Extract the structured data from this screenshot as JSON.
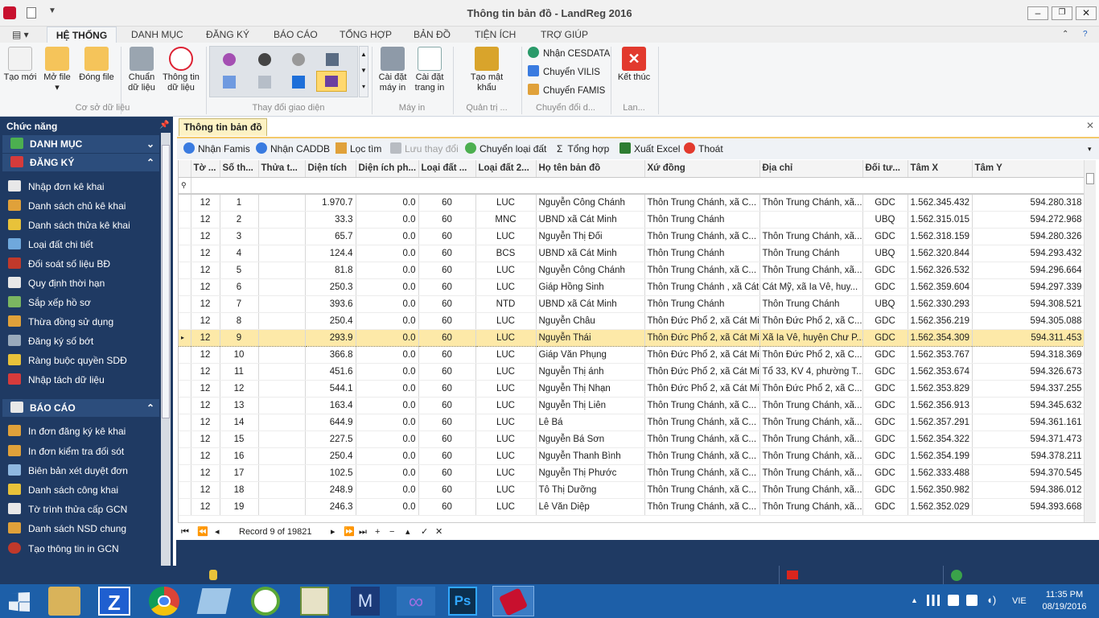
{
  "window": {
    "title": "Thông tin bản đồ - LandReg 2016"
  },
  "ribbon_tabs": [
    "HỆ THỐNG",
    "DANH MỤC",
    "ĐĂNG KÝ",
    "BÁO CÁO",
    "TỔNG HỢP",
    "BẢN ĐỒ",
    "TIỆN ÍCH",
    "TRỢ GIÚP"
  ],
  "ribbon": {
    "new": "Tạo mới",
    "open": "Mở file",
    "close": "Đóng file",
    "convert": "Chuẩn dữ liệu",
    "info": "Thông tin dữ liệu",
    "group1": "Cơ sở dữ liệu",
    "group2": "Thay đổi giao diện",
    "printer": "Cài đặt máy in",
    "page": "Cài đặt trang in",
    "group3": "Máy in",
    "password": "Tạo mật khẩu",
    "group4": "Quản trị ...",
    "cesdata": "Nhận CESDATA",
    "vilis": "Chuyển VILIS",
    "famis": "Chuyển FAMIS",
    "group5": "Chuyển đổi d...",
    "exit": "Kết thúc",
    "group6": "Lan..."
  },
  "left_panel": {
    "title": "Chức năng",
    "sec1": "DANH MỤC",
    "sec2": "ĐĂNG KÝ",
    "dangky_items": [
      "Nhập đơn kê khai",
      "Danh sách chủ kê khai",
      "Danh sách thửa kê khai",
      "Loại đất chi tiết",
      "Đối soát số liệu BĐ",
      "Quy định thời hạn",
      "Sắp xếp hồ sơ",
      "Thừa đồng sử dụng",
      "Đăng ký số bớt",
      "Ràng buộc quyền SDĐ",
      "Nhập tách dữ liệu"
    ],
    "sec3": "BÁO CÁO",
    "baocao_items": [
      "In đơn đăng ký kê khai",
      "In đơn kiểm tra đối sót",
      "Biên bản xét duyệt đơn",
      "Danh sách công khai",
      "Tờ trình thửa cấp GCN",
      "Danh sách NSD chung",
      "Tạo thông tin in GCN"
    ]
  },
  "doc_tab": "Thông tin bản đồ",
  "toolbar": {
    "famis": "Nhận Famis",
    "caddb": "Nhận CADDB",
    "filter": "Lọc tìm",
    "save": "Lưu thay đổi",
    "convert": "Chuyển loại đất",
    "sum": "Tổng hợp",
    "excel": "Xuất Excel",
    "exit": "Thoát"
  },
  "columns": [
    "Tờ ...",
    "Số th...",
    "Thửa t...",
    "Diện tích",
    "Diện ích ph...",
    "Loại đất ...",
    "Loại đất 2...",
    "Họ tên bản đồ",
    "Xứ đồng",
    "Địa chỉ",
    "Đối tư...",
    "Tâm X",
    "Tâm Y"
  ],
  "rows": [
    [
      "12",
      "1",
      "",
      "1.970.7",
      "0.0",
      "60",
      "LUC",
      "Nguyễn Công Chánh",
      "Thôn Trung Chánh, xã C...",
      "Thôn Trung Chánh, xã...",
      "GDC",
      "1.562.345.432",
      "594.280.318"
    ],
    [
      "12",
      "2",
      "",
      "33.3",
      "0.0",
      "60",
      "MNC",
      "UBND xã Cát Minh",
      "Thôn Trung Chánh",
      "",
      "UBQ",
      "1.562.315.015",
      "594.272.968"
    ],
    [
      "12",
      "3",
      "",
      "65.7",
      "0.0",
      "60",
      "LUC",
      "Nguyễn Thị Đối",
      "Thôn Trung Chánh, xã C...",
      "Thôn Trung Chánh, xã...",
      "GDC",
      "1.562.318.159",
      "594.280.326"
    ],
    [
      "12",
      "4",
      "",
      "124.4",
      "0.0",
      "60",
      "BCS",
      "UBND xã Cát Minh",
      "Thôn Trung Chánh",
      "Thôn Trung Chánh",
      "UBQ",
      "1.562.320.844",
      "594.293.432"
    ],
    [
      "12",
      "5",
      "",
      "81.8",
      "0.0",
      "60",
      "LUC",
      "Nguyễn Công Chánh",
      "Thôn Trung Chánh, xã C...",
      "Thôn Trung Chánh, xã...",
      "GDC",
      "1.562.326.532",
      "594.296.664"
    ],
    [
      "12",
      "6",
      "",
      "250.3",
      "0.0",
      "60",
      "LUC",
      "Giáp Hồng Sinh",
      "Thôn Trung Chánh , xã Cát",
      "Cát Mỹ, xã Ia Vê, huy...",
      "GDC",
      "1.562.359.604",
      "594.297.339"
    ],
    [
      "12",
      "7",
      "",
      "393.6",
      "0.0",
      "60",
      "NTD",
      "UBND xã Cát Minh",
      "Thôn Trung Chánh",
      "Thôn Trung Chánh",
      "UBQ",
      "1.562.330.293",
      "594.308.521"
    ],
    [
      "12",
      "8",
      "",
      "250.4",
      "0.0",
      "60",
      "LUC",
      "Nguyễn Châu",
      "Thôn Đức Phổ 2, xã Cát Min",
      "Thôn Đức Phổ 2, xã C...",
      "GDC",
      "1.562.356.219",
      "594.305.088"
    ],
    [
      "12",
      "9",
      "",
      "293.9",
      "0.0",
      "60",
      "LUC",
      "Nguyễn Thái",
      "Thôn Đức Phổ 2, xã Cát Min",
      "Xã Ia Vê, huyện Chư P...",
      "GDC",
      "1.562.354.309",
      "594.311.453"
    ],
    [
      "12",
      "10",
      "",
      "366.8",
      "0.0",
      "60",
      "LUC",
      "Giáp Văn Phụng",
      "Thôn Đức Phổ 2, xã Cát Min",
      "Thôn Đức Phổ 2, xã C...",
      "GDC",
      "1.562.353.767",
      "594.318.369"
    ],
    [
      "12",
      "11",
      "",
      "451.6",
      "0.0",
      "60",
      "LUC",
      "Nguyễn Thị ánh",
      "Thôn Đức Phổ 2, xã Cát Min",
      "Tổ 33, KV 4, phường T...",
      "GDC",
      "1.562.353.674",
      "594.326.673"
    ],
    [
      "12",
      "12",
      "",
      "544.1",
      "0.0",
      "60",
      "LUC",
      "Nguyễn Thị Nhạn",
      "Thôn Đức Phổ 2, xã Cát Min",
      "Thôn Đức Phổ 2, xã C...",
      "GDC",
      "1.562.353.829",
      "594.337.255"
    ],
    [
      "12",
      "13",
      "",
      "163.4",
      "0.0",
      "60",
      "LUC",
      "Nguyễn Thị Liên",
      "Thôn Trung Chánh, xã C...",
      "Thôn Trung Chánh, xã...",
      "GDC",
      "1.562.356.913",
      "594.345.632"
    ],
    [
      "12",
      "14",
      "",
      "644.9",
      "0.0",
      "60",
      "LUC",
      "Lê Bá",
      "Thôn Trung Chánh, xã C...",
      "Thôn Trung Chánh, xã...",
      "GDC",
      "1.562.357.291",
      "594.361.161"
    ],
    [
      "12",
      "15",
      "",
      "227.5",
      "0.0",
      "60",
      "LUC",
      "Nguyễn Bá Sơn",
      "Thôn Trung Chánh, xã C...",
      "Thôn Trung Chánh, xã...",
      "GDC",
      "1.562.354.322",
      "594.371.473"
    ],
    [
      "12",
      "16",
      "",
      "250.4",
      "0.0",
      "60",
      "LUC",
      "Nguyễn Thanh Bình",
      "Thôn Trung Chánh, xã C...",
      "Thôn Trung Chánh, xã...",
      "GDC",
      "1.562.354.199",
      "594.378.211"
    ],
    [
      "12",
      "17",
      "",
      "102.5",
      "0.0",
      "60",
      "LUC",
      "Nguyễn Thị Phước",
      "Thôn Trung Chánh, xã C...",
      "Thôn Trung Chánh, xã...",
      "GDC",
      "1.562.333.488",
      "594.370.545"
    ],
    [
      "12",
      "18",
      "",
      "248.9",
      "0.0",
      "60",
      "LUC",
      "Tô Thị Dưỡng",
      "Thôn Trung Chánh, xã C...",
      "Thôn Trung Chánh, xã...",
      "GDC",
      "1.562.350.982",
      "594.386.012"
    ],
    [
      "12",
      "19",
      "",
      "246.3",
      "0.0",
      "60",
      "LUC",
      "Lê Văn Diệp",
      "Thôn Trung Chánh, xã C...",
      "Thôn Trung Chánh, xã...",
      "GDC",
      "1.562.352.029",
      "594.393.668"
    ]
  ],
  "navigator": {
    "record": "Record 9 of 19821"
  },
  "clock": {
    "time": "11:35 PM",
    "date": "08/19/2016",
    "lang": "VIE"
  },
  "colors": {
    "panel": "#1f3a63",
    "selected_row": "#fde9a8",
    "taskbar": "#1d5fa8"
  }
}
